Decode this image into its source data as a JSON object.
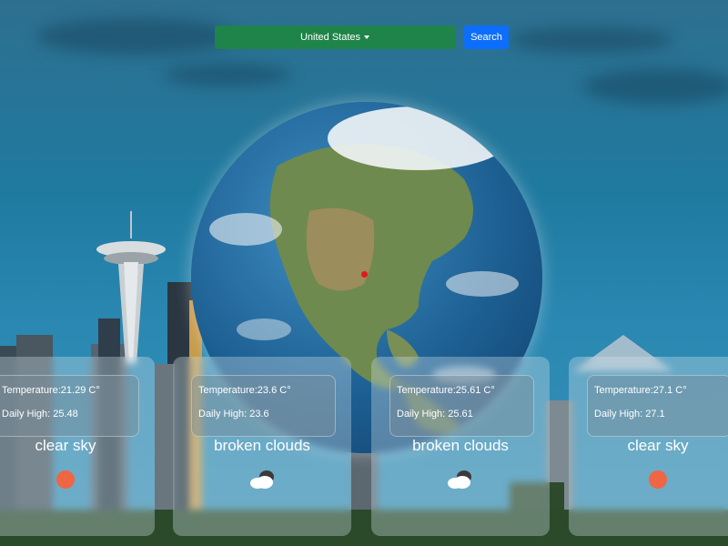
{
  "search": {
    "country": "United States",
    "button_label": "Search"
  },
  "forecast": [
    {
      "temperature": "Temperature:21.29 C°",
      "daily_high": "Daily High: 25.48",
      "description": "clear sky",
      "icon": "sun-icon"
    },
    {
      "temperature": "Temperature:23.6 C°",
      "daily_high": "Daily High: 23.6",
      "description": "broken clouds",
      "icon": "cloud-icon"
    },
    {
      "temperature": "Temperature:25.61 C°",
      "daily_high": "Daily High: 25.61",
      "description": "broken clouds",
      "icon": "cloud-icon"
    },
    {
      "temperature": "Temperature:27.1 C°",
      "daily_high": "Daily High: 27.1",
      "description": "clear sky",
      "icon": "sun-icon"
    }
  ],
  "colors": {
    "select_bg": "#1e8449",
    "button_bg": "#0d6efd",
    "sun": "#ee6644",
    "marker": "#e01a1a"
  }
}
